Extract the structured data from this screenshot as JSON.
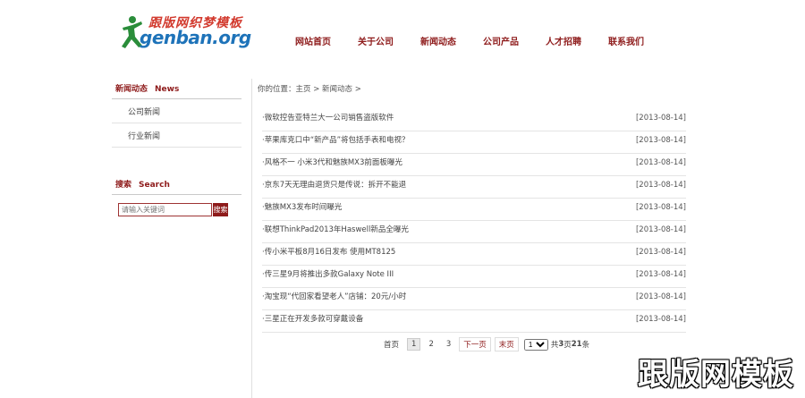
{
  "header": {
    "logo_cn": "跟版网织梦模板",
    "logo_en": "genban.org",
    "nav": [
      "网站首页",
      "关于公司",
      "新闻动态",
      "公司产品",
      "人才招聘",
      "联系我们"
    ]
  },
  "sidebar": {
    "news_title_cn": "新闻动态",
    "news_title_en": "News",
    "items": [
      "公司新闻",
      "行业新闻"
    ],
    "search_title_cn": "搜索",
    "search_title_en": "Search",
    "search_placeholder": "请输入关键词",
    "search_button": "搜索"
  },
  "breadcrumb": "你的位置：主页 > 新闻动态 >",
  "news": [
    {
      "title": "·微软控告亚特兰大一公司销售盗版软件",
      "date": "[2013-08-14]"
    },
    {
      "title": "·苹果库克口中“新产品”将包括手表和电视？",
      "date": "[2013-08-14]"
    },
    {
      "title": "·风格不一 小米3代和魅族MX3前面板曝光",
      "date": "[2013-08-14]"
    },
    {
      "title": "·京东7天无理由退货只是传说：拆开不能退",
      "date": "[2013-08-14]"
    },
    {
      "title": "·魅族MX3发布时间曝光",
      "date": "[2013-08-14]"
    },
    {
      "title": "·联想ThinkPad2013年Haswell新品全曝光",
      "date": "[2013-08-14]"
    },
    {
      "title": "·传小米平板8月16日发布 使用MT8125",
      "date": "[2013-08-14]"
    },
    {
      "title": "·传三星9月将推出多款Galaxy Note III",
      "date": "[2013-08-14]"
    },
    {
      "title": "·淘宝现“代回家看望老人”店铺：20元/小时",
      "date": "[2013-08-14]"
    },
    {
      "title": "·三星正在开发多款可穿戴设备",
      "date": "[2013-08-14]"
    }
  ],
  "pager": {
    "first": "首页",
    "pages": [
      "1",
      "2",
      "3"
    ],
    "next": "下一页",
    "last": "末页",
    "select_value": "1",
    "total_prefix": "共",
    "total_pages": "3",
    "total_mid": "页",
    "total_records": "21",
    "total_suffix": "条"
  },
  "watermark": "跟版网模板",
  "colors": {
    "accent": "#8e1b1b",
    "logo_red": "#d23a2e",
    "logo_blue": "#1e73b9"
  }
}
